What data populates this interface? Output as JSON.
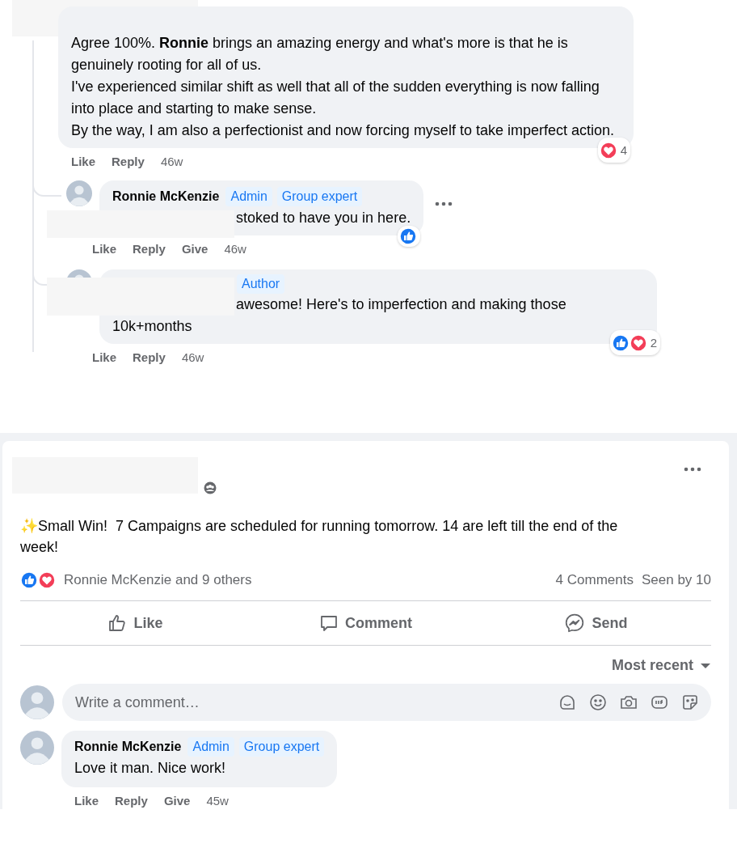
{
  "thread": {
    "comment": {
      "text": "Agree 100%. **Ronnie** brings an amazing energy and what's more is that he is genuinely rooting for all of us.\nI've experienced similar shift as well that all of the sudden everything is now falling into place and starting to make sense.\nBy the way, I am also a perfectionist and now forcing myself to take imperfect action.",
      "reactions": [
        {
          "kind": "love"
        }
      ],
      "reaction_count": "4",
      "actions": [
        "Like",
        "Reply"
      ],
      "time": "46w"
    },
    "replies": [
      {
        "author": "Ronnie McKenzie",
        "badges": [
          "Admin",
          "Group expert"
        ],
        "covered": true,
        "text": "stoked to have you in here.",
        "reactions": [
          {
            "kind": "like"
          }
        ],
        "actions": [
          "Like",
          "Reply",
          "Give"
        ],
        "time": "46w"
      },
      {
        "badges": [
          "Author"
        ],
        "covered": true,
        "text": "awesome! Here's to imperfection and making those 10k+months",
        "reactions": [
          {
            "kind": "like"
          },
          {
            "kind": "love"
          }
        ],
        "reaction_count": "2",
        "actions": [
          "Like",
          "Reply"
        ],
        "time": "46w"
      }
    ]
  },
  "post": {
    "text": "✨Small Win!  7 Campaigns are scheduled for running tomorrow. 14 are left till the end of the week!",
    "reactions": [
      {
        "kind": "like"
      },
      {
        "kind": "love"
      }
    ],
    "reacted_by": "Ronnie McKenzie and 9 others",
    "comments_count": "4 Comments",
    "seen_by": "Seen by 10",
    "actions": [
      {
        "kind": "like",
        "label": "Like"
      },
      {
        "kind": "comment",
        "label": "Comment"
      },
      {
        "kind": "send",
        "label": "Send"
      }
    ],
    "sort": "Most recent",
    "composer": {
      "placeholder": "Write a comment…"
    },
    "comments": [
      {
        "author": "Ronnie McKenzie",
        "badges": [
          "Admin",
          "Group expert"
        ],
        "text": "Love it man. Nice work!",
        "actions": [
          "Like",
          "Reply",
          "Give"
        ],
        "time": "45w"
      }
    ]
  }
}
